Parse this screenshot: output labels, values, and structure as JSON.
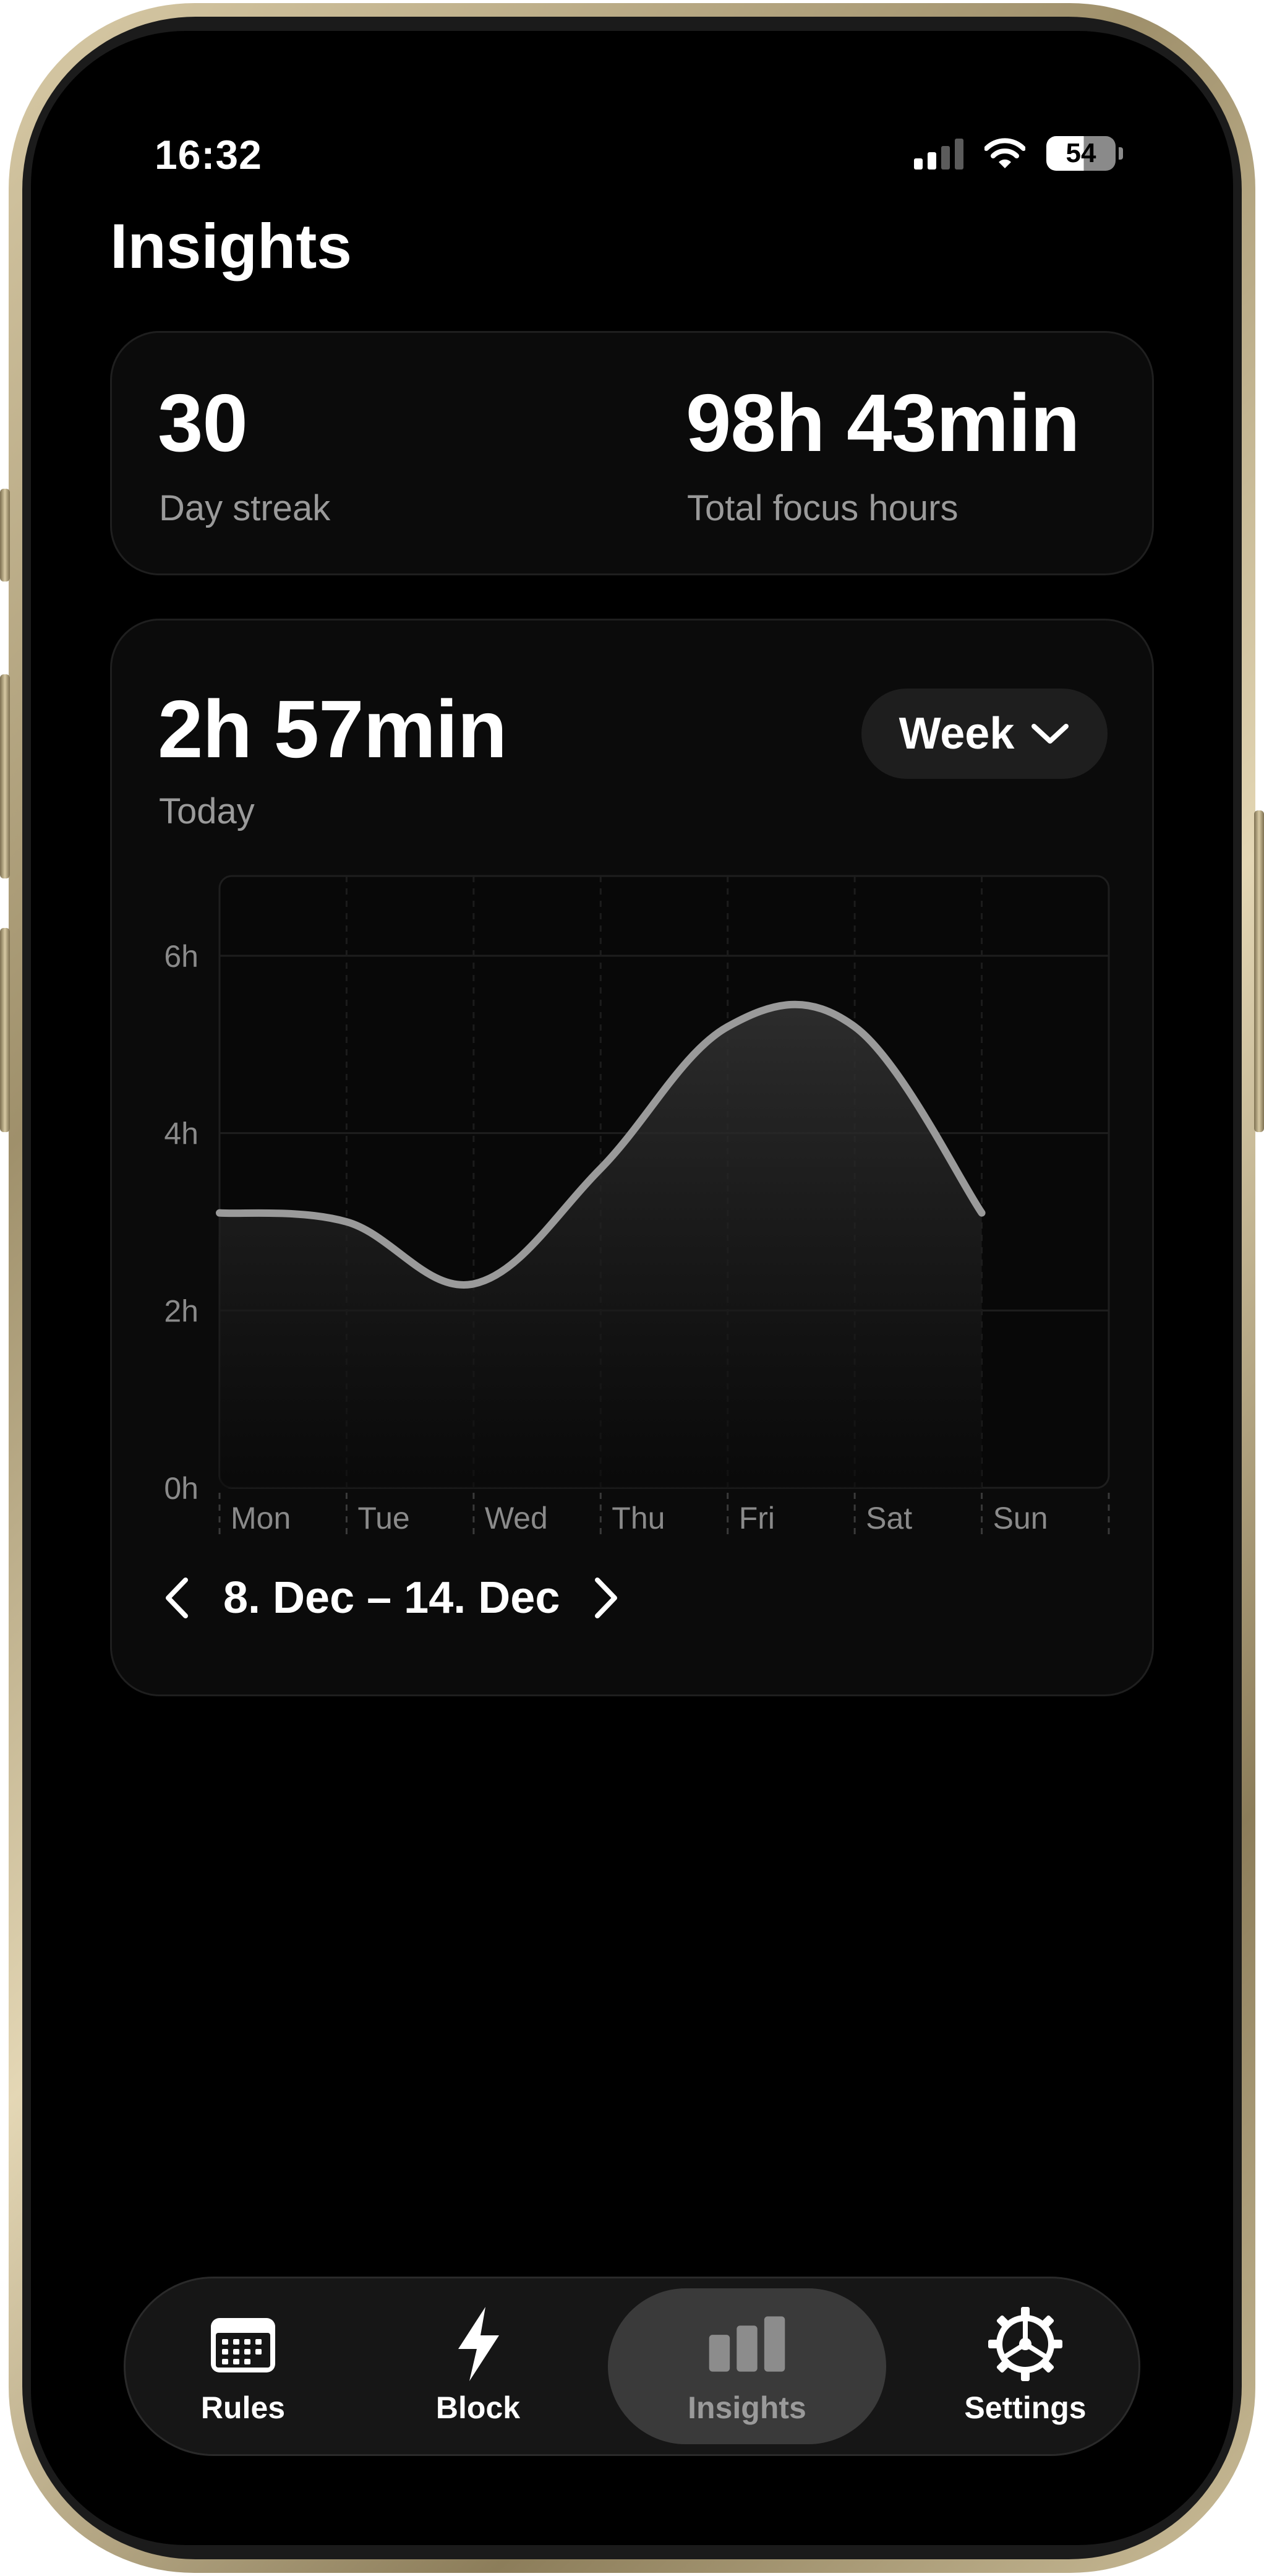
{
  "status_bar": {
    "time": "16:32",
    "battery": "54",
    "signal_bars": 2
  },
  "page": {
    "title": "Insights"
  },
  "stats": {
    "streak_value": "30",
    "streak_label": "Day streak",
    "total_value": "98h 43min",
    "total_label": "Total focus hours"
  },
  "today": {
    "value": "2h 57min",
    "label": "Today"
  },
  "range_select": {
    "selected": "Week"
  },
  "chart_data": {
    "type": "area",
    "x": [
      "Mon",
      "Tue",
      "Wed",
      "Thu",
      "Fri",
      "Sat",
      "Sun"
    ],
    "series": [
      {
        "values": [
          3.1,
          3.0,
          2.3,
          3.6,
          5.2,
          5.2,
          3.1
        ]
      }
    ],
    "y_ticks": [
      "0h",
      "2h",
      "4h",
      "6h"
    ],
    "ylim": [
      0,
      6.9
    ],
    "grid": true,
    "colors": {
      "line": "#9a9a9a",
      "grid": "#1e1e1e",
      "area_top": "#333333"
    }
  },
  "date_nav": {
    "range": "8. Dec – 14. Dec"
  },
  "tabs": [
    {
      "label": "Rules",
      "icon": "calendar-icon",
      "active": false
    },
    {
      "label": "Block",
      "icon": "bolt-icon",
      "active": false
    },
    {
      "label": "Insights",
      "icon": "bar-chart-icon",
      "active": true
    },
    {
      "label": "Settings",
      "icon": "gear-icon",
      "active": false
    }
  ]
}
